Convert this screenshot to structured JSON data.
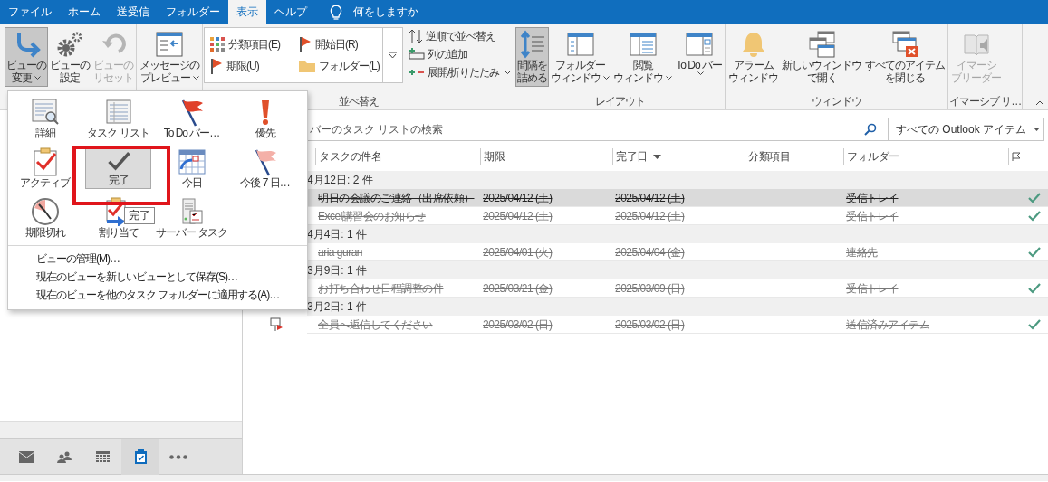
{
  "tabs": [
    {
      "label": "ファイル",
      "selected": false
    },
    {
      "label": "ホーム",
      "selected": false
    },
    {
      "label": "送受信",
      "selected": false
    },
    {
      "label": "フォルダー",
      "selected": false
    },
    {
      "label": "表示",
      "selected": true
    },
    {
      "label": "ヘルプ",
      "selected": false
    }
  ],
  "tell_me": "何をしますか",
  "ribbon": {
    "groups": [
      {
        "buttons": [
          {
            "lines": [
              "ビューの",
              "変更"
            ],
            "has_menu": true,
            "pressed": true,
            "disabled": false
          },
          {
            "lines": [
              "ビューの",
              "設定"
            ],
            "has_menu": false,
            "pressed": false,
            "disabled": false
          },
          {
            "lines": [
              "ビューの",
              "リセット"
            ],
            "has_menu": false,
            "pressed": false,
            "disabled": true
          }
        ]
      },
      {
        "buttons": [
          {
            "lines": [
              "メッセージの",
              "プレビュー"
            ],
            "has_menu": true,
            "pressed": false,
            "disabled": false
          }
        ]
      },
      {
        "label": "並べ替え",
        "gallery": [
          "分類項目(E)",
          "開始日(R)",
          "期限(U)",
          "フォルダー(L)"
        ],
        "commands": [
          {
            "label": "逆順で並べ替え",
            "has_menu": false
          },
          {
            "label": "列の追加",
            "has_menu": false
          },
          {
            "label": "展開/折りたたみ",
            "has_menu": true
          }
        ]
      },
      {
        "label": "レイアウト",
        "buttons": [
          {
            "lines": [
              "間隔を",
              "詰める"
            ],
            "has_menu": false,
            "pressed": true,
            "disabled": false
          },
          {
            "lines": [
              "フォルダー",
              "ウィンドウ"
            ],
            "has_menu": true,
            "pressed": false,
            "disabled": false
          },
          {
            "lines": [
              "閲覧",
              "ウィンドウ"
            ],
            "has_menu": true,
            "pressed": false,
            "disabled": false
          },
          {
            "lines": [
              "To Do バー"
            ],
            "has_menu": true,
            "pressed": false,
            "disabled": false
          }
        ]
      },
      {
        "label": "ウィンドウ",
        "buttons": [
          {
            "lines": [
              "アラーム",
              "ウィンドウ"
            ],
            "has_menu": false,
            "pressed": false,
            "disabled": false
          },
          {
            "lines": [
              "新しいウィンドウ",
              "で開く"
            ],
            "has_menu": false,
            "pressed": false,
            "disabled": false
          },
          {
            "lines": [
              "すべてのアイテム",
              "を閉じる"
            ],
            "has_menu": false,
            "pressed": false,
            "disabled": false
          }
        ]
      },
      {
        "label": "イマーシブ リ…",
        "buttons": [
          {
            "lines": [
              "イマーシ",
              "ブリーダー"
            ],
            "has_menu": false,
            "pressed": false,
            "disabled": true
          }
        ]
      }
    ]
  },
  "view_menu": {
    "views": [
      {
        "label": "詳細",
        "selected": false
      },
      {
        "label": "タスク リスト",
        "selected": false
      },
      {
        "label": "To Do バー…",
        "selected": false
      },
      {
        "label": "優先",
        "selected": false
      },
      {
        "label": "アクティブ",
        "selected": false
      },
      {
        "label": "完了",
        "selected": true
      },
      {
        "label": "今日",
        "selected": false
      },
      {
        "label": "今後 7 日…",
        "selected": false
      },
      {
        "label": "期限切れ",
        "selected": false
      },
      {
        "label": "割り当て",
        "selected": false
      },
      {
        "label": "サーバー タスク",
        "selected": false
      }
    ],
    "tooltip": "完了",
    "commands": [
      "ビューの管理(M)…",
      "現在のビューを新しいビューとして保存(S)…",
      "現在のビューを他のタスク フォルダーに適用する(A)…"
    ]
  },
  "search": {
    "placeholder": "バーのタスク リストの検索",
    "scope": "すべての Outlook アイテム"
  },
  "table": {
    "columns": [
      {
        "label": "タスクの件名",
        "sorted": false
      },
      {
        "label": "期限",
        "sorted": false
      },
      {
        "label": "完了日",
        "sorted": true
      },
      {
        "label": "分類項目",
        "sorted": false
      },
      {
        "label": "フォルダー",
        "sorted": false
      }
    ],
    "groups": [
      {
        "label": "4月12日: 2 件",
        "rows": [
          {
            "subject": "明日の会議のご連絡（出席依頼）",
            "due": "2025/04/12 (土)",
            "completed": "2025/04/12 (土)",
            "folder": "受信トレイ",
            "selected": true,
            "complete": true
          },
          {
            "subject": "Excel講習会のお知らせ",
            "due": "2025/04/12 (土)",
            "completed": "2025/04/12 (土)",
            "folder": "受信トレイ",
            "selected": false,
            "complete": true
          }
        ]
      },
      {
        "label": "4月4日: 1 件",
        "rows": [
          {
            "subject": "aria guran",
            "due": "2025/04/01 (火)",
            "completed": "2025/04/04 (金)",
            "folder": "連絡先",
            "selected": false,
            "complete": true
          }
        ]
      },
      {
        "label": "3月9日: 1 件",
        "rows": [
          {
            "subject": "お打ち合わせ日程調整の件",
            "due": "2025/03/21 (金)",
            "completed": "2025/03/09 (日)",
            "folder": "受信トレイ",
            "selected": false,
            "complete": true
          }
        ]
      },
      {
        "label": "3月2日: 1 件",
        "rows": [
          {
            "subject": "全員へ返信してください",
            "due": "2025/03/02 (日)",
            "completed": "2025/03/02 (日)",
            "folder": "送信済みアイテム",
            "selected": false,
            "complete": true,
            "has_icon": true
          }
        ]
      }
    ]
  },
  "nav_bar": [
    {
      "selected": false
    },
    {
      "selected": false
    },
    {
      "selected": false
    },
    {
      "selected": true
    },
    {
      "selected": false
    }
  ]
}
